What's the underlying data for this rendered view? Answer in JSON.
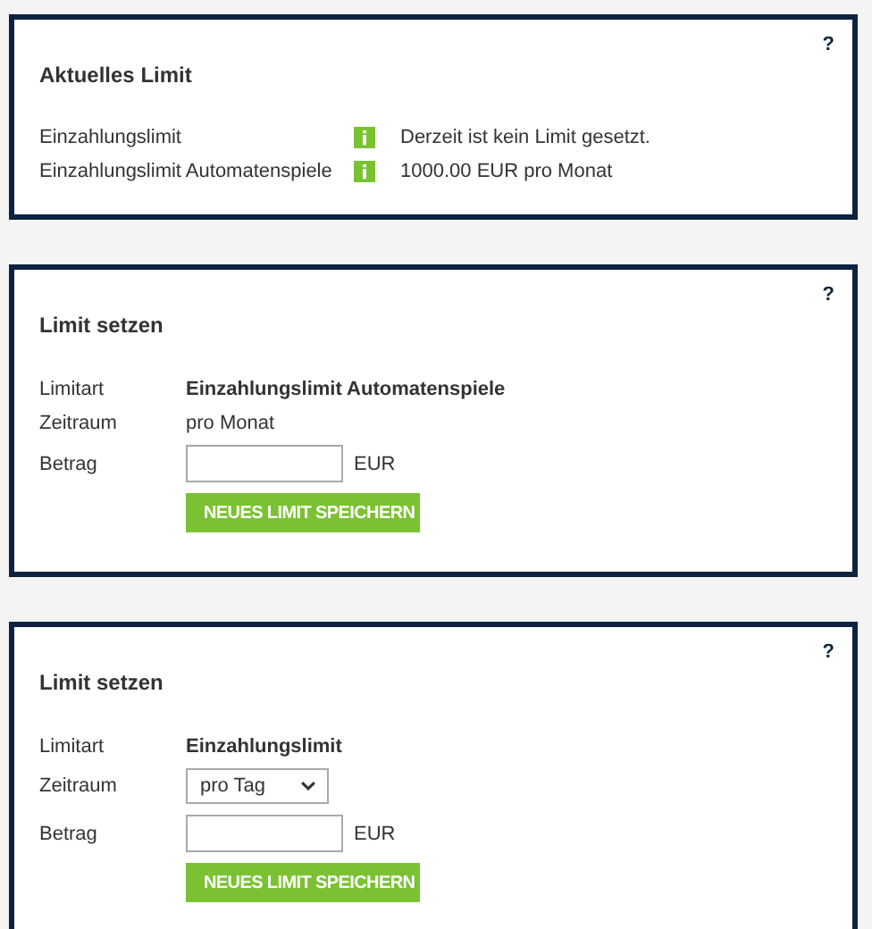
{
  "panels": [
    {
      "kind": "overview",
      "help": "?",
      "title": "Aktuelles Limit",
      "rows": [
        {
          "label": "Einzahlungslimit",
          "value": "Derzeit ist kein Limit gesetzt."
        },
        {
          "label": "Einzahlungslimit Automatenspiele",
          "value": "1000.00 EUR pro Monat"
        }
      ]
    },
    {
      "kind": "form",
      "help": "?",
      "title": "Limit setzen",
      "fields": [
        {
          "kind": "strong",
          "label": "Limitart",
          "value": "Einzahlungslimit Automatenspiele"
        },
        {
          "kind": "text",
          "label": "Zeitraum",
          "value": "pro Monat"
        },
        {
          "kind": "input",
          "label": "Betrag",
          "unit": "EUR"
        }
      ],
      "button": "NEUES LIMIT SPEICHERN"
    },
    {
      "kind": "form",
      "help": "?",
      "title": "Limit setzen",
      "fields": [
        {
          "kind": "strong",
          "label": "Limitart",
          "value": "Einzahlungslimit"
        },
        {
          "kind": "select",
          "label": "Zeitraum",
          "value": "pro Tag"
        },
        {
          "kind": "input",
          "label": "Betrag",
          "unit": "EUR"
        }
      ],
      "button": "NEUES LIMIT SPEICHERN"
    }
  ]
}
